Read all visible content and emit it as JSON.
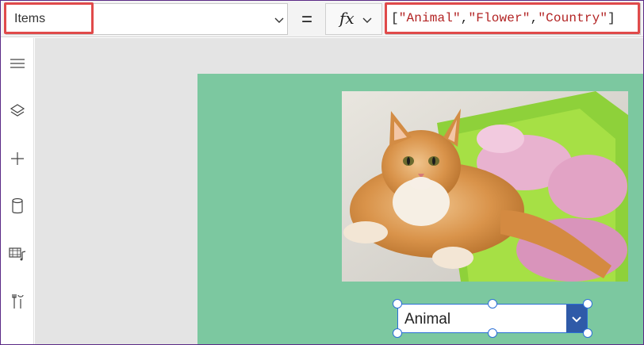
{
  "formula_bar": {
    "property": "Items",
    "equals": "=",
    "fx_label": "fx",
    "formula_tokens": [
      "[",
      "\"Animal\"",
      ",",
      "\"Flower\"",
      ",",
      "\"Country\"",
      "]"
    ]
  },
  "left_rail": {
    "icons": [
      "hamburger-menu-icon",
      "layers-icon",
      "plus-icon",
      "database-icon",
      "media-icon",
      "tools-icon"
    ]
  },
  "screen": {
    "background": "#7cc8a0",
    "image_subject": "cat-photo",
    "dropdown": {
      "selected": "Animal",
      "accent": "#2f5aa8"
    }
  },
  "colors": {
    "highlight": "#e04a4a",
    "selection": "#2b6fd6",
    "frame": "#5b2a86"
  }
}
